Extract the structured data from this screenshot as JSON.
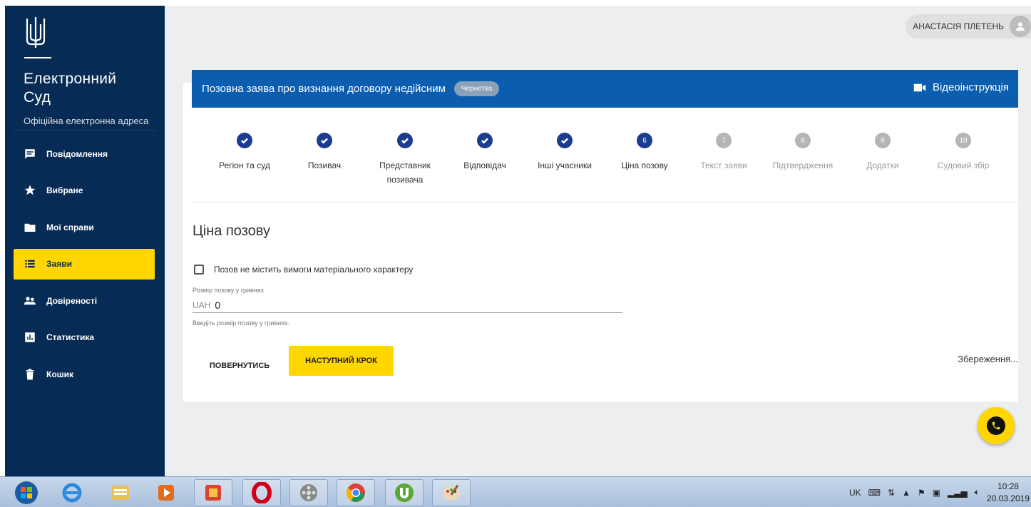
{
  "sidebar": {
    "brand_line1": "Електронний",
    "brand_line2": "Суд",
    "subtitle": "Офіційна електронна адреса",
    "items": [
      {
        "label": "Повідомлення",
        "icon": "message-icon"
      },
      {
        "label": "Вибране",
        "icon": "star-icon"
      },
      {
        "label": "Мої справи",
        "icon": "folder-icon"
      },
      {
        "label": "Заяви",
        "icon": "list-icon",
        "active": true
      },
      {
        "label": "Довіреності",
        "icon": "people-icon"
      },
      {
        "label": "Статистика",
        "icon": "chart-icon"
      },
      {
        "label": "Кошик",
        "icon": "trash-icon"
      }
    ]
  },
  "user": {
    "name": "АНАСТАСІЯ ПЛЕТЕНЬ"
  },
  "header": {
    "title": "Позовна заява про визнання договору недійсним",
    "badge": "Чернетка",
    "video_link": "Відеоінструкція"
  },
  "steps": [
    {
      "num": "1",
      "label": "Регіон та суд",
      "state": "done"
    },
    {
      "num": "2",
      "label": "Позивач",
      "state": "done"
    },
    {
      "num": "3",
      "label": "Представник позивача",
      "state": "done"
    },
    {
      "num": "4",
      "label": "Відповідач",
      "state": "done"
    },
    {
      "num": "5",
      "label": "Інші учасники",
      "state": "done"
    },
    {
      "num": "6",
      "label": "Ціна позову",
      "state": "current"
    },
    {
      "num": "7",
      "label": "Текст заяви",
      "state": "todo"
    },
    {
      "num": "8",
      "label": "Підтвердження",
      "state": "todo"
    },
    {
      "num": "9",
      "label": "Додатки",
      "state": "todo"
    },
    {
      "num": "10",
      "label": "Судовий збір",
      "state": "todo"
    }
  ],
  "form": {
    "section_title": "Ціна позову",
    "checkbox_label": "Позов не містить вимоги матеріального характеру",
    "amount_label": "Розмір позову у гривнях",
    "currency": "UAH",
    "amount_value": "0",
    "amount_hint": "Введіть розмір позову у гривнях."
  },
  "buttons": {
    "back": "ПОВЕРНУТИСЬ",
    "next": "НАСТУПНИЙ КРОК"
  },
  "status": {
    "saving": "Збереження..."
  },
  "taskbar": {
    "lang": "UK",
    "time": "10:28",
    "date": "20.03.2019"
  },
  "colors": {
    "sidebar": "#062b55",
    "accent_yellow": "#ffd600",
    "header_blue": "#0b5db0",
    "step_done": "#1a3d8f"
  }
}
